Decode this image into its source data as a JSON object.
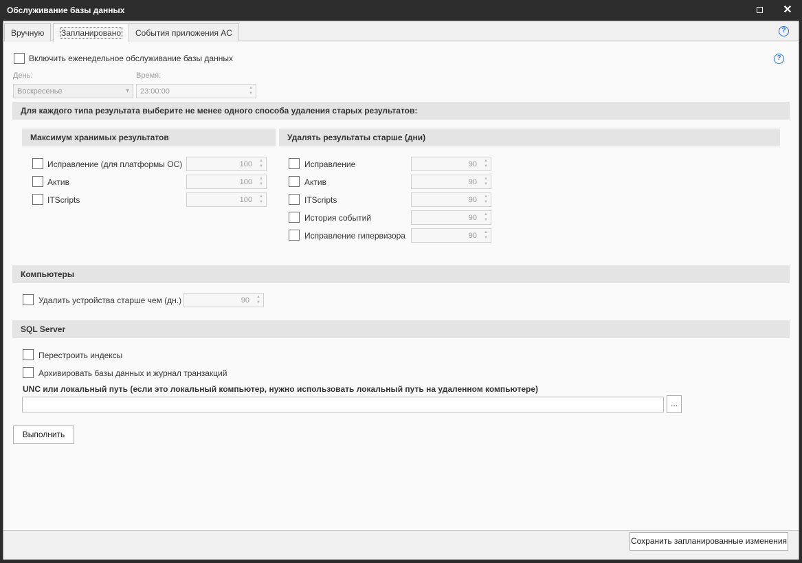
{
  "window": {
    "title": "Обслуживание базы данных",
    "maximize_icon": "maximize-icon",
    "close_icon": "close-icon",
    "close_glyph": "✕"
  },
  "tabs": [
    {
      "label": "Вручную",
      "active": false
    },
    {
      "label": "Запланировано",
      "active": true
    },
    {
      "label": "События приложения AC",
      "active": false
    }
  ],
  "help_glyph": "?",
  "weekly": {
    "enable_label": "Включить еженедельное обслуживание базы данных",
    "day_label": "День:",
    "day_value": "Воскресенье",
    "time_label": "Время:",
    "time_value": "23:00:00"
  },
  "retention": {
    "header": "Для каждого типа результата выберите не менее одного способа удаления старых результатов:",
    "max_header": "Максимум хранимых результатов",
    "max_items": [
      {
        "label": "Исправление (для платформы ОС)",
        "value": "100"
      },
      {
        "label": "Актив",
        "value": "100"
      },
      {
        "label": "ITScripts",
        "value": "100"
      }
    ],
    "age_header": "Удалять результаты старше (дни)",
    "age_items": [
      {
        "label": "Исправление",
        "value": "90"
      },
      {
        "label": "Актив",
        "value": "90"
      },
      {
        "label": "ITScripts",
        "value": "90"
      },
      {
        "label": "История событий",
        "value": "90"
      },
      {
        "label": "Исправление гипервизора",
        "value": "90"
      }
    ]
  },
  "computers": {
    "header": "Компьютеры",
    "delete_label": "Удалить устройства старше чем (дн.)",
    "delete_value": "90"
  },
  "sql": {
    "header": "SQL Server",
    "rebuild_label": "Перестроить индексы",
    "archive_label": "Архивировать базы данных и журнал транзакций",
    "path_label": "UNC или локальный путь (если это локальный компьютер, нужно использовать локальный путь на удаленном компьютере)",
    "path_value": "",
    "browse_label": "..."
  },
  "actions": {
    "run_label": "Выполнить",
    "save_label": "Сохранить запланированные изменения"
  },
  "colors": {
    "titlebar": "#2d2d2d",
    "band": "#e4e4e4",
    "help_accent": "#2a6ecb"
  }
}
